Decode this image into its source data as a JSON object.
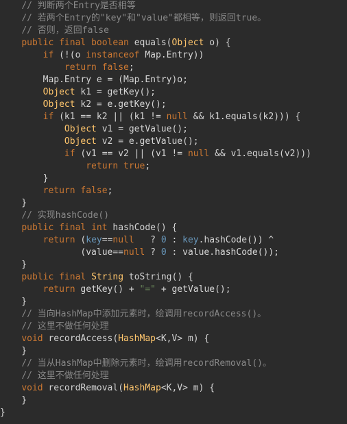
{
  "code": {
    "c1": "// 判断两个Entry是否相等",
    "c2": "// 若两个Entry的\"key\"和\"value\"都相等，则返回true。",
    "c3": "// 否则，返回false",
    "kw_public": "public",
    "kw_final": "final",
    "kw_boolean": "boolean",
    "kw_int": "int",
    "kw_void": "void",
    "kw_if": "if",
    "kw_return": "return",
    "kw_instanceof": "instanceof",
    "kw_false": "false",
    "kw_true": "true",
    "kw_null": "null",
    "fn_equals": " equals(",
    "cl_Object": "Object",
    "p_o": " o) {",
    "if1_a": " (!(o ",
    "if1_b": " Map.Entry))",
    "semi": ";",
    "l_entry": "        Map.Entry e = (Map.Entry)o;",
    "l_k1a": " k1 = getKey();",
    "l_k2a": " k2 = e.getKey();",
    "if2_a": " (k1 == k2 || (k1 != ",
    "if2_b": " && k1.equals(k2))) {",
    "l_v1a": " v1 = getValue();",
    "l_v2a": " v2 = e.getValue();",
    "if3_a": " (v1 == v2 || (v1 != ",
    "if3_b": " && v1.equals(v2)))",
    "cb1": "        }",
    "cb2": "    }",
    "c4": "// 实现hashCode()",
    "fn_hash": " hashCode() {",
    "hash1_a": " (",
    "hash1_key": "key",
    "hash1_eq": "==",
    "hash1_q": "   ? ",
    "hash1_zero": "0",
    "hash1_c": " : ",
    "hash1_d": ".hashCode()) ^",
    "hash2_a": "               (value==",
    "hash2_b": " ? ",
    "hash2_c": " : value.hashCode());",
    "cl_String": "String",
    "fn_tostr": " toString() {",
    "ts_a": " getKey() + ",
    "ts_eq": "\"=\"",
    "ts_b": " + getValue();",
    "c5": "// 当向HashMap中添加元素时，绘调用recordAccess()。",
    "c6": "// 这里不做任何处理",
    "fn_ra": " recordAccess(",
    "cl_HashMap": "HashMap",
    "p_map": "<K,V> m) {",
    "c7": "// 当从HashMap中删除元素时，绘调用recordRemoval()。",
    "c8": "// 这里不做任何处理",
    "fn_rr": " recordRemoval(",
    "cb3": "}"
  }
}
